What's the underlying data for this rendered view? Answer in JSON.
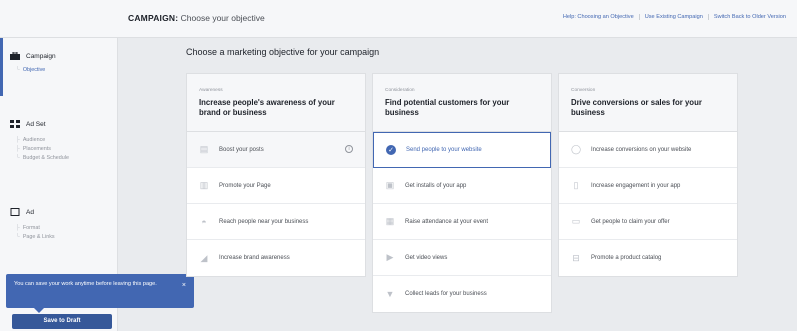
{
  "header": {
    "title_bold": "CAMPAIGN:",
    "title_rest": "Choose your objective",
    "links": [
      "Help: Choosing an Objective",
      "Use Existing Campaign",
      "Switch Back to Older Version"
    ]
  },
  "sidebar": {
    "sections": [
      {
        "label": "Campaign",
        "icon": "briefcase-icon",
        "subs": [
          "Objective"
        ]
      },
      {
        "label": "Ad Set",
        "icon": "grid-icon",
        "subs": [
          "Audience",
          "Placements",
          "Budget & Schedule"
        ]
      },
      {
        "label": "Ad",
        "icon": "square-icon",
        "subs": [
          "Format",
          "Page & Links"
        ]
      }
    ]
  },
  "toast": {
    "text": "You can save your work anytime before leaving this page.",
    "close": "×"
  },
  "draft_button": "Save to Draft",
  "main": {
    "title": "Choose a marketing objective for your campaign",
    "columns": [
      {
        "category": "Awareness",
        "heading": "Increase people's awareness of your brand or business",
        "options": [
          {
            "label": "Boost your posts",
            "icon": "thumb-icon",
            "glyph": "▤"
          },
          {
            "label": "Promote your Page",
            "icon": "like-icon",
            "glyph": "▥"
          },
          {
            "label": "Reach people near your business",
            "icon": "person-icon",
            "glyph": "◓"
          },
          {
            "label": "Increase brand awareness",
            "icon": "megaphone-icon",
            "glyph": "◢"
          }
        ]
      },
      {
        "category": "Consideration",
        "heading": "Find potential customers for your business",
        "options": [
          {
            "label": "Send people to your website",
            "icon": "cursor-icon",
            "glyph": "✓"
          },
          {
            "label": "Get installs of your app",
            "icon": "app-icon",
            "glyph": "▣"
          },
          {
            "label": "Raise attendance at your event",
            "icon": "calendar-icon",
            "glyph": "▦"
          },
          {
            "label": "Get video views",
            "icon": "video-icon",
            "glyph": "▶"
          },
          {
            "label": "Collect leads for your business",
            "icon": "funnel-icon",
            "glyph": "▼"
          }
        ]
      },
      {
        "category": "Conversion",
        "heading": "Drive conversions or sales for your business",
        "options": [
          {
            "label": "Increase conversions on your website",
            "icon": "globe-icon",
            "glyph": "◯"
          },
          {
            "label": "Increase engagement in your app",
            "icon": "phone-icon",
            "glyph": "▯"
          },
          {
            "label": "Get people to claim your offer",
            "icon": "tag-icon",
            "glyph": "▭"
          },
          {
            "label": "Promote a product catalog",
            "icon": "cart-icon",
            "glyph": "⊟"
          }
        ]
      }
    ]
  },
  "info_glyph": "i",
  "colors": {
    "accent": "#4267b2",
    "sidebar_bg": "#f6f7f9",
    "page_bg": "#e9ebee"
  }
}
